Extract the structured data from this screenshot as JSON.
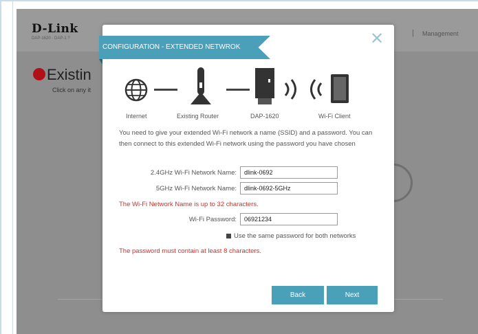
{
  "header": {
    "logo": "D-Link",
    "logo_sub": "DAP-1620 · DAP-1 ?",
    "separator": "|",
    "menu_item": "Management"
  },
  "page": {
    "title": "Existin",
    "subtitle": "Click on any it"
  },
  "modal": {
    "title": "CONFIGURATION - EXTENDED NETWROK",
    "close_glyph": "✕",
    "diagram_labels": [
      "Internet",
      "Existing Router",
      "DAP-1620",
      "Wi-Fi Client"
    ],
    "description": "You need to give your extended Wi-Fi network a name (SSID) and a password. You can then connect to this extended Wi-Fi network using the password you have chosen",
    "fields": {
      "ssid_24_label": "2.4GHz Wi-Fi Network Name:",
      "ssid_24_value": "dlink-0692",
      "ssid_5_label": "5GHz Wi-Fi Network Name:",
      "ssid_5_value": "dlink-0692-5GHz",
      "ssid_error": "The Wi-Fi Network Name is up to 32 characters.",
      "password_label": "Wi-Fi Password:",
      "password_value": "06921234",
      "same_password_label": "Use the same password for both networks",
      "password_error": "The password must contain at least 8 characters."
    },
    "buttons": {
      "back": "Back",
      "next": "Next"
    }
  },
  "colors": {
    "accent": "#4aa0b8",
    "error": "#d72e25",
    "overlay": "#8e8e8e",
    "brand_red": "#b01018"
  },
  "icons": [
    "globe-icon",
    "router-icon",
    "dap-extender-icon",
    "wifi-signal-icon",
    "tablet-icon",
    "close-icon"
  ]
}
